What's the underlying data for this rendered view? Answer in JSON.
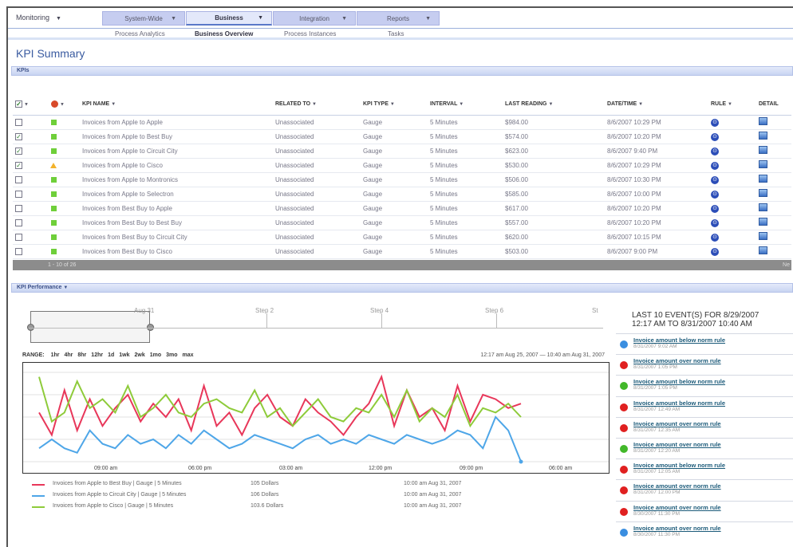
{
  "nav": {
    "monitoring": "Monitoring",
    "tabs": [
      "System-Wide",
      "Business",
      "Integration",
      "Reports"
    ],
    "subtabs": [
      "Process Analytics",
      "Business Overview",
      "Process Instances",
      "Tasks"
    ]
  },
  "page_title": "KPI Summary",
  "kpis_section": "KPIs",
  "table": {
    "headers": [
      "KPI NAME",
      "RELATED TO",
      "KPI TYPE",
      "INTERVAL",
      "LAST READING",
      "DATE/TIME",
      "RULE",
      "DETAIL"
    ],
    "rows": [
      {
        "checked": false,
        "status": "green",
        "name": "Invoices from Apple to Apple",
        "related": "Unassociated",
        "type": "Gauge",
        "interval": "5 Minutes",
        "reading": "$984.00",
        "datetime": "8/6/2007 10:29 PM"
      },
      {
        "checked": true,
        "status": "green",
        "name": "Invoices from Apple to Best Buy",
        "related": "Unassociated",
        "type": "Gauge",
        "interval": "5 Minutes",
        "reading": "$574.00",
        "datetime": "8/6/2007 10:20 PM"
      },
      {
        "checked": true,
        "status": "green",
        "name": "Invoices from Apple to Circuit City",
        "related": "Unassociated",
        "type": "Gauge",
        "interval": "5 Minutes",
        "reading": "$623.00",
        "datetime": "8/6/2007 9:40 PM"
      },
      {
        "checked": true,
        "status": "yellow",
        "name": "Invoices from Apple to Cisco",
        "related": "Unassociated",
        "type": "Gauge",
        "interval": "5 Minutes",
        "reading": "$530.00",
        "datetime": "8/6/2007 10:29 PM"
      },
      {
        "checked": false,
        "status": "green",
        "name": "Invoices from Apple to Montronics",
        "related": "Unassociated",
        "type": "Gauge",
        "interval": "5 Minutes",
        "reading": "$506.00",
        "datetime": "8/6/2007 10:30 PM"
      },
      {
        "checked": false,
        "status": "green",
        "name": "Invoices from Apple to Selectron",
        "related": "Unassociated",
        "type": "Gauge",
        "interval": "5 Minutes",
        "reading": "$585.00",
        "datetime": "8/6/2007 10:00 PM"
      },
      {
        "checked": false,
        "status": "green",
        "name": "Invoices from Best Buy to Apple",
        "related": "Unassociated",
        "type": "Gauge",
        "interval": "5 Minutes",
        "reading": "$617.00",
        "datetime": "8/6/2007 10:20 PM"
      },
      {
        "checked": false,
        "status": "green",
        "name": "Invoices from Best Buy to Best Buy",
        "related": "Unassociated",
        "type": "Gauge",
        "interval": "5 Minutes",
        "reading": "$557.00",
        "datetime": "8/6/2007 10:20 PM"
      },
      {
        "checked": false,
        "status": "green",
        "name": "Invoices from Best Buy to Circuit City",
        "related": "Unassociated",
        "type": "Gauge",
        "interval": "5 Minutes",
        "reading": "$620.00",
        "datetime": "8/6/2007 10:15 PM"
      },
      {
        "checked": false,
        "status": "green",
        "name": "Invoices from Best Buy to Cisco",
        "related": "Unassociated",
        "type": "Gauge",
        "interval": "5 Minutes",
        "reading": "$503.00",
        "datetime": "8/6/2007 9:00 PM"
      }
    ],
    "pager": "1 - 10 of 26",
    "pager_end": "Ne"
  },
  "perf_section": "KPI Performance",
  "timeline": {
    "steps": [
      "Aug 31",
      "Step 2",
      "Step 4",
      "Step 6",
      "St"
    ]
  },
  "range": {
    "label": "RANGE:",
    "options": [
      "1hr",
      "4hr",
      "8hr",
      "12hr",
      "1d",
      "1wk",
      "2wk",
      "1mo",
      "3mo",
      "max"
    ],
    "dates": "12:17 am Aug 25, 2007 — 10:40 am Aug 31, 2007"
  },
  "x_ticks": [
    "09:00 am",
    "06:00 pm",
    "03:00 am",
    "12:00 pm",
    "09:00 pm",
    "06:00 am"
  ],
  "chart_data": {
    "type": "line",
    "series": [
      {
        "name": "Invoices from Apple to Best Buy | Gauge | 5 Minutes",
        "color": "#e8375a",
        "values": [
          0.55,
          0.3,
          0.8,
          0.35,
          0.7,
          0.4,
          0.6,
          0.75,
          0.45,
          0.65,
          0.5,
          0.7,
          0.35,
          0.85,
          0.4,
          0.55,
          0.3,
          0.6,
          0.75,
          0.5,
          0.4,
          0.7,
          0.55,
          0.45,
          0.3,
          0.5,
          0.65,
          0.95,
          0.4,
          0.8,
          0.5,
          0.6,
          0.35,
          0.85,
          0.45,
          0.75,
          0.7,
          0.6,
          0.65
        ]
      },
      {
        "name": "Invoices from Apple to Circuit City | Gauge | 5 Minutes",
        "color": "#4ea6e8",
        "values": [
          0.15,
          0.25,
          0.15,
          0.1,
          0.35,
          0.2,
          0.15,
          0.3,
          0.2,
          0.25,
          0.15,
          0.3,
          0.2,
          0.35,
          0.25,
          0.15,
          0.2,
          0.3,
          0.25,
          0.2,
          0.15,
          0.25,
          0.3,
          0.2,
          0.25,
          0.2,
          0.3,
          0.25,
          0.2,
          0.3,
          0.25,
          0.2,
          0.25,
          0.35,
          0.3,
          0.15,
          0.5,
          0.35,
          0.0
        ]
      },
      {
        "name": "Invoices from Apple to Cisco | Gauge | 5 Minutes",
        "color": "#8ecb3a",
        "values": [
          0.95,
          0.45,
          0.55,
          0.9,
          0.6,
          0.7,
          0.55,
          0.85,
          0.5,
          0.6,
          0.75,
          0.55,
          0.5,
          0.65,
          0.7,
          0.6,
          0.55,
          0.8,
          0.5,
          0.6,
          0.4,
          0.55,
          0.7,
          0.5,
          0.45,
          0.6,
          0.55,
          0.75,
          0.5,
          0.8,
          0.45,
          0.6,
          0.5,
          0.75,
          0.4,
          0.6,
          0.55,
          0.65,
          0.5
        ]
      }
    ],
    "legend_values": [
      "105 Dollars",
      "106 Dollars",
      "103.6 Dollars"
    ],
    "legend_times": [
      "10:00 am Aug 31, 2007",
      "10:00 am Aug 31, 2007",
      "10:00 am Aug 31, 2007"
    ]
  },
  "events": {
    "title_line1": "LAST 10 EVENT(S) FOR 8/29/2007",
    "title_line2": "12:17 AM TO 8/31/2007 10:40 AM",
    "items": [
      {
        "color": "#3a8ee0",
        "label": "Invoice amount below norm rule",
        "time": "8/31/2007 9:02 AM"
      },
      {
        "color": "#e02020",
        "label": "Invoice amount over norm rule",
        "time": "8/31/2007 1:05 PM"
      },
      {
        "color": "#42b82a",
        "label": "Invoice amount below norm rule",
        "time": "8/31/2007 1:05 PM"
      },
      {
        "color": "#e02020",
        "label": "Invoice amount below norm rule",
        "time": "8/31/2007 12:49 AM"
      },
      {
        "color": "#e02020",
        "label": "Invoice amount over norm rule",
        "time": "8/31/2007 12:35 AM"
      },
      {
        "color": "#42b82a",
        "label": "Invoice amount over norm rule",
        "time": "8/31/2007 12:20 AM"
      },
      {
        "color": "#e02020",
        "label": "Invoice amount below norm rule",
        "time": "8/31/2007 12:05 AM"
      },
      {
        "color": "#e02020",
        "label": "Invoice amount over norm rule",
        "time": "8/31/2007 12:00 PM"
      },
      {
        "color": "#e02020",
        "label": "Invoice amount over norm rule",
        "time": "8/30/2007 11:30 PM"
      },
      {
        "color": "#3a8ee0",
        "label": "Invoice amount over norm rule",
        "time": "8/30/2007 11:30 PM"
      }
    ]
  }
}
